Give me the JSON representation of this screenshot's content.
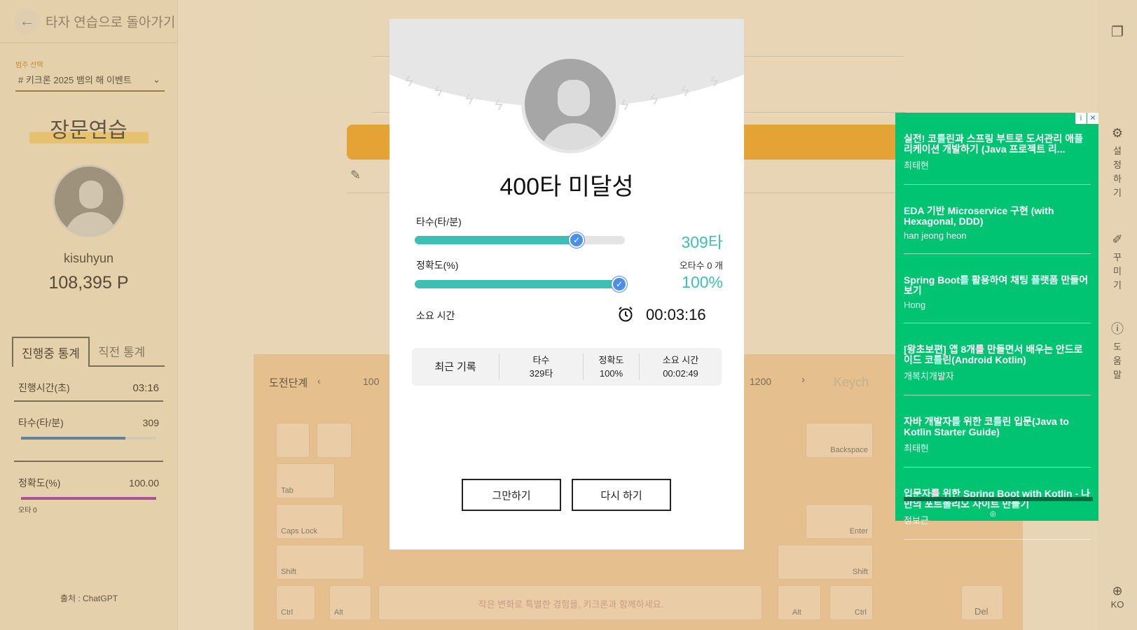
{
  "sidebar": {
    "back_label": "타자 연습으로 돌아가기",
    "category_caption": "범주 선택",
    "category_value": "# 키크론 2025 뱀의 해 이벤트",
    "page_title": "장문연습",
    "username": "kisuhyun",
    "points": "108,395 P",
    "tabs": [
      "진행중 통계",
      "직전 통계"
    ],
    "stats": {
      "time_label": "진행시간(초)",
      "time_value": "03:16",
      "speed_label": "타수(타/분)",
      "speed_value": "309",
      "speed_fraction": 0.77,
      "accuracy_label": "정확도(%)",
      "accuracy_value": "100.00",
      "accuracy_fraction": 1.0,
      "errors_label": "오타 0"
    },
    "source": "출처 : ChatGPT"
  },
  "background": {
    "stage_label": "도전단계",
    "stage_start": "100",
    "stage_end": "1200",
    "brand": "Keych",
    "keyboard_banner": "작은 변화로 특별한 경험을, 키크론과 함께하세요.",
    "keys": {
      "backspace": "Backspace",
      "tab": "Tab",
      "capslock": "Caps Lock",
      "enter": "Enter",
      "shift": "Shift",
      "ctrl": "Ctrl",
      "alt": "Alt",
      "del": "Del"
    }
  },
  "right_rail": {
    "settings": "설정하기",
    "decorate": "꾸미기",
    "help": "도움말",
    "language": "KO"
  },
  "modal": {
    "title": "400타 미달성",
    "speed_label": "타수(타/분)",
    "speed_value": "309타",
    "speed_fraction": 0.77,
    "accuracy_label": "정확도(%)",
    "accuracy_value": "100%",
    "accuracy_fraction": 1.0,
    "errors_text": "오타수 0 개",
    "time_label": "소요 시간",
    "time_value": "00:03:16",
    "history": {
      "label": "최근 기록",
      "speed_header": "타수",
      "speed_value": "329타",
      "accuracy_header": "정확도",
      "accuracy_value": "100%",
      "time_header": "소요 시간",
      "time_value": "00:02:49"
    },
    "stop_button": "그만하기",
    "retry_button": "다시 하기"
  },
  "ad": {
    "items": [
      {
        "title": "실전! 코틀린과 스프링 부트로 도서관리 애플리케이션 개발하기 (Java 프로젝트 리...",
        "author": "최태현"
      },
      {
        "title": "EDA 기반 Microservice 구현 (with Hexagonal, DDD)",
        "author": "han jeong heon"
      },
      {
        "title": "Spring Boot를 활용하여 채팅 플랫폼 만들어보기",
        "author": "Hong"
      },
      {
        "title": "[왕초보편] 앱 8개를 만들면서 배우는 안드로이드 코틀린(Android Kotlin)",
        "author": "개복치개발자"
      },
      {
        "title": "자바 개발자를 위한 코틀린 입문(Java to Kotlin Starter Guide)",
        "author": "최태현"
      },
      {
        "title": "입문자를 위한 Spring Boot with Kotlin - 나만의 포트폴리오 사이트 만들기",
        "author": "정보근"
      }
    ]
  },
  "colors": {
    "accent_teal": "#3dbfb3",
    "knob_blue": "#4d8fe6",
    "ad_green": "#00c471",
    "orange": "#f2a623"
  }
}
